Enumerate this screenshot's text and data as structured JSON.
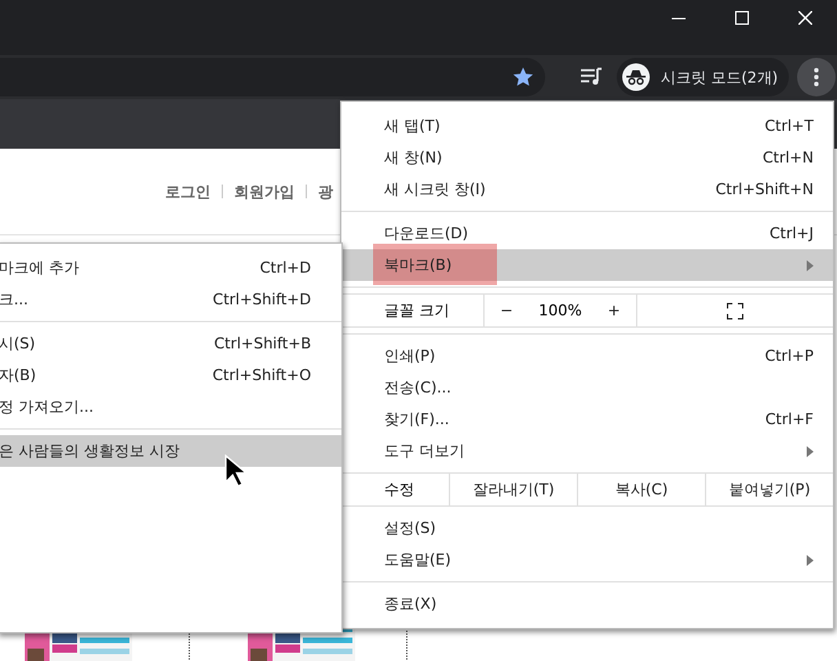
{
  "window": {
    "controls": [
      {
        "kind": "minimize"
      },
      {
        "kind": "maximize"
      },
      {
        "kind": "close"
      }
    ]
  },
  "toolbar": {
    "profile": {
      "label": "시크릿 모드(2개)"
    }
  },
  "page": {
    "links": [
      {
        "label": "로그인"
      },
      {
        "label": "회원가입"
      },
      {
        "label": "광"
      }
    ]
  },
  "main_menu": {
    "items": [
      {
        "kind": "item",
        "label": "새 탭(T)",
        "shortcut": "Ctrl+T",
        "submenu": false,
        "selected": false
      },
      {
        "kind": "item",
        "label": "새 창(N)",
        "shortcut": "Ctrl+N",
        "submenu": false,
        "selected": false
      },
      {
        "kind": "item",
        "label": "새 시크릿 창(I)",
        "shortcut": "Ctrl+Shift+N",
        "submenu": false,
        "selected": false
      },
      {
        "kind": "separator"
      },
      {
        "kind": "item",
        "label": "다운로드(D)",
        "shortcut": "Ctrl+J",
        "submenu": false,
        "selected": false
      },
      {
        "kind": "item",
        "label": "북마크(B)",
        "submenu": true,
        "selected": true,
        "annotated": true
      },
      {
        "kind": "separator"
      },
      {
        "kind": "zoom",
        "label": "글꼴 크기",
        "minus": "−",
        "value": "100%",
        "plus": "+"
      },
      {
        "kind": "separator"
      },
      {
        "kind": "item",
        "label": "인쇄(P)",
        "shortcut": "Ctrl+P",
        "submenu": false,
        "selected": false
      },
      {
        "kind": "item",
        "label": "전송(C)...",
        "submenu": false,
        "selected": false
      },
      {
        "kind": "item",
        "label": "찾기(F)...",
        "shortcut": "Ctrl+F",
        "submenu": false,
        "selected": false
      },
      {
        "kind": "item",
        "label": "도구 더보기",
        "submenu": true,
        "selected": false
      },
      {
        "kind": "edit",
        "label": "수정",
        "buttons": [
          "잘라내기(T)",
          "복사(C)",
          "붙여넣기(P)"
        ]
      },
      {
        "kind": "item",
        "label": "설정(S)",
        "submenu": false,
        "selected": false
      },
      {
        "kind": "item",
        "label": "도움말(E)",
        "submenu": true,
        "selected": false
      },
      {
        "kind": "separator"
      },
      {
        "kind": "item",
        "label": "종료(X)",
        "submenu": false,
        "selected": false
      }
    ]
  },
  "bookmarks_menu": {
    "items": [
      {
        "kind": "item",
        "label": "마크에 추가",
        "shortcut": "Ctrl+D",
        "selected": false
      },
      {
        "kind": "item",
        "label": "크...",
        "shortcut": "Ctrl+Shift+D",
        "selected": false
      },
      {
        "kind": "separator"
      },
      {
        "kind": "item",
        "label": "시(S)",
        "shortcut": "Ctrl+Shift+B",
        "selected": false
      },
      {
        "kind": "item",
        "label": "자(B)",
        "shortcut": "Ctrl+Shift+O",
        "selected": false
      },
      {
        "kind": "item",
        "label": "정 가져오기...",
        "selected": false
      },
      {
        "kind": "separator"
      },
      {
        "kind": "item",
        "label": "은 사람들의 생활정보 시장",
        "selected": true
      }
    ]
  }
}
